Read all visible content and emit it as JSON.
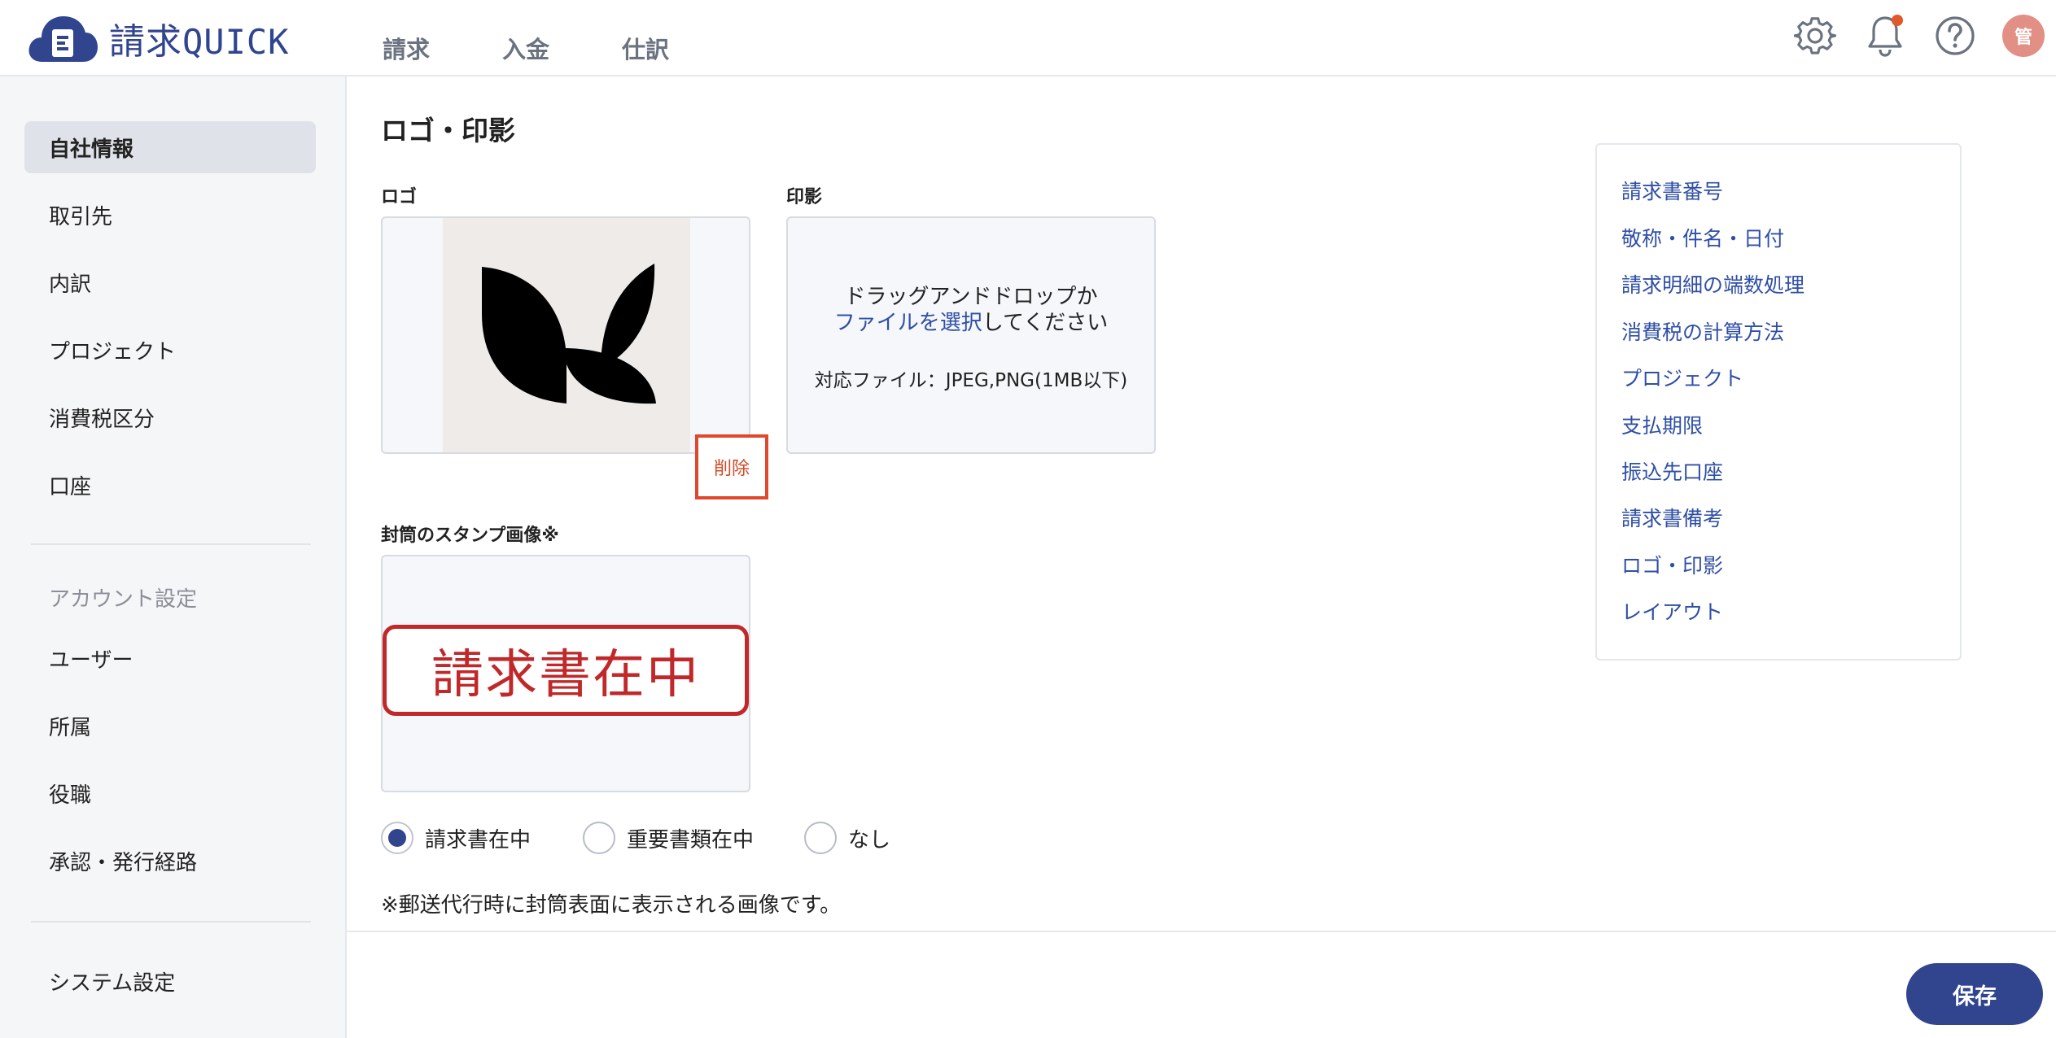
{
  "app": {
    "name_kanji": "請求",
    "name_latin": "QUICK"
  },
  "nav": [
    {
      "label": "請求"
    },
    {
      "label": "入金"
    },
    {
      "label": "仕訳"
    }
  ],
  "header": {
    "avatar_initial": "管",
    "notification_badge_color": "#e0592a"
  },
  "sidebar": {
    "items": [
      {
        "label": "自社情報",
        "active": true
      },
      {
        "label": "取引先"
      },
      {
        "label": "内訳"
      },
      {
        "label": "プロジェクト"
      },
      {
        "label": "消費税区分"
      },
      {
        "label": "口座"
      }
    ],
    "account_section_title": "アカウント設定",
    "account_items": [
      {
        "label": "ユーザー"
      },
      {
        "label": "所属"
      },
      {
        "label": "役職"
      },
      {
        "label": "承認・発行経路"
      }
    ],
    "system_item": {
      "label": "システム設定"
    }
  },
  "main": {
    "title": "ロゴ・印影",
    "logo": {
      "label": "ロゴ",
      "delete_label": "削除"
    },
    "seal": {
      "label": "印影",
      "drop_line1": "ドラッグアンドドロップか",
      "drop_link": "ファイルを選択",
      "drop_line2_rest": "してください",
      "supported": "対応ファイル：JPEG,PNG(1MB以下)"
    },
    "envelope": {
      "label": "封筒のスタンプ画像※",
      "stamp_text": "請求書在中",
      "options": [
        {
          "label": "請求書在中",
          "checked": true
        },
        {
          "label": "重要書類在中",
          "checked": false
        },
        {
          "label": "なし",
          "checked": false
        }
      ],
      "note": "※郵送代行時に封筒表面に表示される画像です。"
    }
  },
  "toc": {
    "items": [
      {
        "label": "請求書番号"
      },
      {
        "label": "敬称・件名・日付"
      },
      {
        "label": "請求明細の端数処理"
      },
      {
        "label": "消費税の計算方法"
      },
      {
        "label": "プロジェクト"
      },
      {
        "label": "支払期限"
      },
      {
        "label": "振込先口座"
      },
      {
        "label": "請求書備考"
      },
      {
        "label": "ロゴ・印影"
      },
      {
        "label": "レイアウト"
      }
    ]
  },
  "footer": {
    "save_label": "保存"
  },
  "colors": {
    "brand": "#31458f",
    "link": "#2f4fa6",
    "danger": "#e0482d",
    "stamp_red": "#c0282a"
  }
}
